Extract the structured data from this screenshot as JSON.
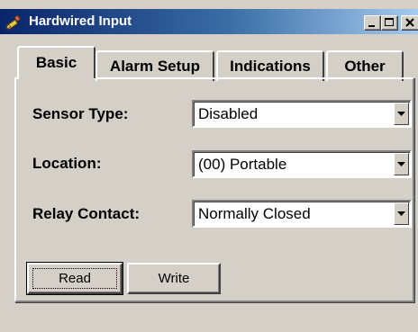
{
  "window": {
    "title": "Hardwired Input",
    "icon": "pencil-icon",
    "controls": {
      "minimize": "minimize-icon",
      "maximize": "maximize-icon",
      "close": "close-icon"
    }
  },
  "tabs": [
    {
      "label": "Basic",
      "selected": true
    },
    {
      "label": "Alarm Setup",
      "selected": false
    },
    {
      "label": "Indications",
      "selected": false
    },
    {
      "label": "Other",
      "selected": false
    }
  ],
  "fields": {
    "sensor_type": {
      "label": "Sensor Type:",
      "value": "Disabled"
    },
    "location": {
      "label": "Location:",
      "value": "(00) Portable"
    },
    "relay_contact": {
      "label": "Relay Contact:",
      "value": "Normally Closed"
    }
  },
  "buttons": {
    "read": "Read",
    "write": "Write"
  }
}
